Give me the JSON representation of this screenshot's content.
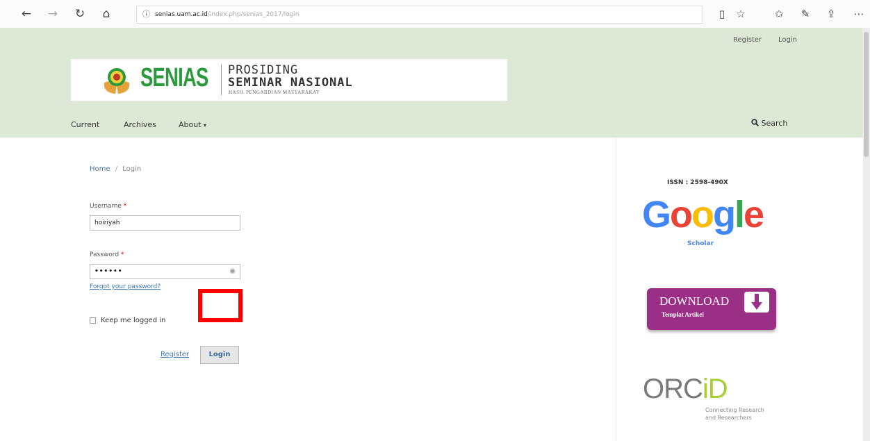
{
  "browser": {
    "url_domain": "senias.uam.ac.id",
    "url_path": "/index.php/senias_2017/login"
  },
  "header": {
    "top_links": {
      "register": "Register",
      "login": "Login"
    },
    "logo": {
      "name": "SENIAS",
      "line1": "PROSIDING",
      "line2": "SEMINAR NASIONAL",
      "line3": "HASIL PENGABDIAN MASYARAKAT"
    },
    "nav": {
      "current": "Current",
      "archives": "Archives",
      "about": "About"
    },
    "search_label": "Search"
  },
  "breadcrumb": {
    "home": "Home",
    "separator": "/",
    "current": "Login"
  },
  "form": {
    "username_label": "Username",
    "username_value": "hoiriyah",
    "password_label": "Password",
    "password_value": "••••••",
    "required_mark": "*",
    "forgot_link": "Forgot your password?",
    "keep_logged_in": "Keep me logged in",
    "register_link": "Register",
    "login_button": "Login"
  },
  "sidebar": {
    "issn": "ISSN : 2598-490X",
    "scholar_label": "Scholar",
    "download_line1": "DOWNLOAD",
    "download_line2": "Templat Artikel",
    "orcid_sub_line1": "Connecting Research",
    "orcid_sub_line2": "and Researchers"
  },
  "colors": {
    "header_bg": "#dde9d6",
    "accent_green": "#2a9a3c",
    "link_blue": "#3c74b4",
    "highlight_red": "#ff0000"
  }
}
